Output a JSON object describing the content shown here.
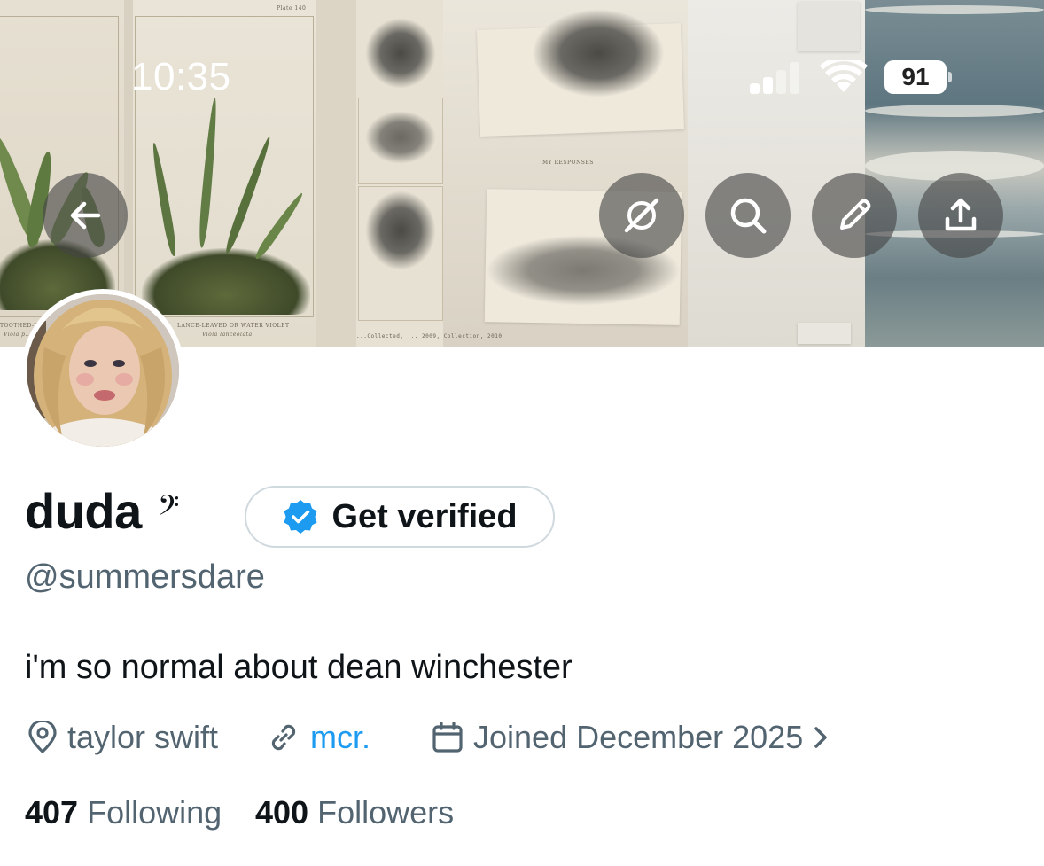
{
  "status_bar": {
    "time": "10:35",
    "battery_level": "91",
    "signal_bars": 2,
    "signal_bars_total": 4,
    "icons": [
      "cellular-signal-icon",
      "wifi-icon",
      "battery-icon"
    ]
  },
  "banner": {
    "plate_caption": "Plate 140",
    "left_caption_1": "TOOTHED-BORDER...",
    "left_caption_2": "Viola p...",
    "mid_caption_1": "LANCE-LEAVED OR WATER VIOLET",
    "mid_caption_2": "Viola lanceolata",
    "sketch_note": "MY RESPONSES",
    "typed_caption": "...Collected, ... 2009, Collection, 2010"
  },
  "header_actions": {
    "back_icon": "arrow-left-icon",
    "actions": [
      {
        "name": "grok-icon"
      },
      {
        "name": "search-icon"
      },
      {
        "name": "pencil-icon"
      },
      {
        "name": "share-icon"
      }
    ]
  },
  "profile": {
    "display_name": "duda",
    "name_emoji": "𝄢",
    "get_verified_label": "Get verified",
    "handle": "@summersdare",
    "bio": "i'm so normal about dean winchester",
    "location": "taylor swift",
    "website": "mcr.",
    "joined": "Joined December 2025",
    "following_count": "407",
    "following_label": "Following",
    "followers_count": "400",
    "followers_label": "Followers"
  },
  "colors": {
    "text_primary": "#0f1419",
    "text_secondary": "#536471",
    "link": "#1d9bf0",
    "verified_badge": "#1d9bf0",
    "border": "#cfd9de"
  }
}
